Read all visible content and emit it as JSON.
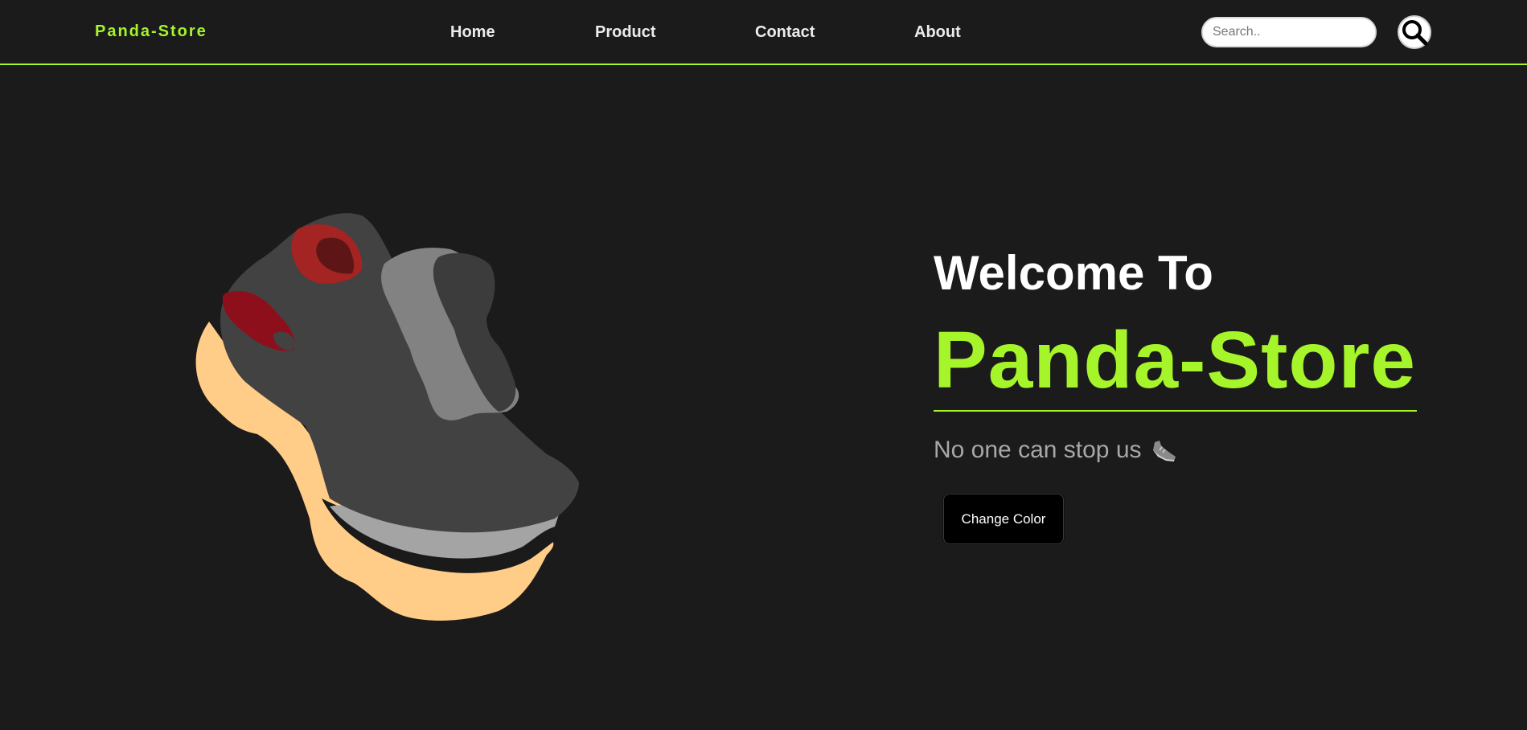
{
  "header": {
    "brand": "Panda-Store",
    "nav": [
      {
        "label": "Home"
      },
      {
        "label": "Product"
      },
      {
        "label": "Contact"
      },
      {
        "label": "About"
      }
    ],
    "search": {
      "placeholder": "Search..",
      "value": "",
      "icon": "magnifier-icon"
    }
  },
  "hero": {
    "welcome": "Welcome To",
    "title": "Panda-Store",
    "tagline": "No one can stop us",
    "tagline_icon": "sneaker-icon",
    "button_label": "Change Color",
    "image": "sneaker-illustration"
  },
  "colors": {
    "background": "#1b1b1b",
    "accent": "#a6f52a",
    "text": "#ffffff",
    "muted": "#a8a8a8"
  }
}
